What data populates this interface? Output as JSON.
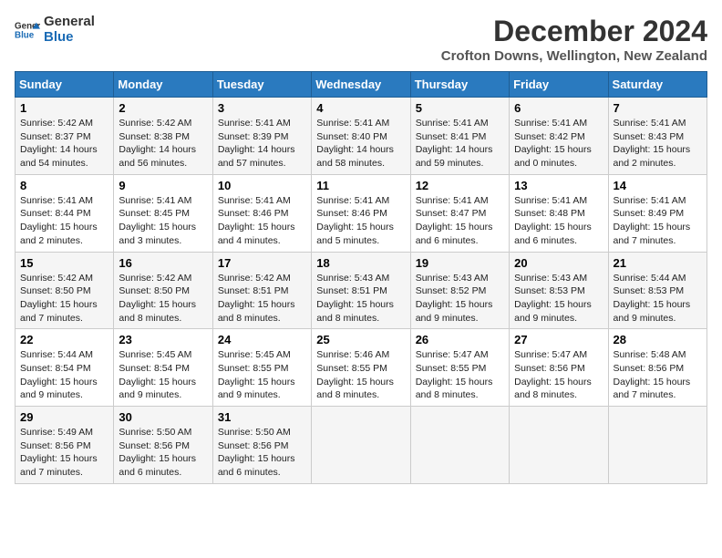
{
  "header": {
    "logo_line1": "General",
    "logo_line2": "Blue",
    "month": "December 2024",
    "location": "Crofton Downs, Wellington, New Zealand"
  },
  "weekdays": [
    "Sunday",
    "Monday",
    "Tuesday",
    "Wednesday",
    "Thursday",
    "Friday",
    "Saturday"
  ],
  "weeks": [
    [
      {
        "day": "1",
        "info": "Sunrise: 5:42 AM\nSunset: 8:37 PM\nDaylight: 14 hours\nand 54 minutes."
      },
      {
        "day": "2",
        "info": "Sunrise: 5:42 AM\nSunset: 8:38 PM\nDaylight: 14 hours\nand 56 minutes."
      },
      {
        "day": "3",
        "info": "Sunrise: 5:41 AM\nSunset: 8:39 PM\nDaylight: 14 hours\nand 57 minutes."
      },
      {
        "day": "4",
        "info": "Sunrise: 5:41 AM\nSunset: 8:40 PM\nDaylight: 14 hours\nand 58 minutes."
      },
      {
        "day": "5",
        "info": "Sunrise: 5:41 AM\nSunset: 8:41 PM\nDaylight: 14 hours\nand 59 minutes."
      },
      {
        "day": "6",
        "info": "Sunrise: 5:41 AM\nSunset: 8:42 PM\nDaylight: 15 hours\nand 0 minutes."
      },
      {
        "day": "7",
        "info": "Sunrise: 5:41 AM\nSunset: 8:43 PM\nDaylight: 15 hours\nand 2 minutes."
      }
    ],
    [
      {
        "day": "8",
        "info": "Sunrise: 5:41 AM\nSunset: 8:44 PM\nDaylight: 15 hours\nand 2 minutes."
      },
      {
        "day": "9",
        "info": "Sunrise: 5:41 AM\nSunset: 8:45 PM\nDaylight: 15 hours\nand 3 minutes."
      },
      {
        "day": "10",
        "info": "Sunrise: 5:41 AM\nSunset: 8:46 PM\nDaylight: 15 hours\nand 4 minutes."
      },
      {
        "day": "11",
        "info": "Sunrise: 5:41 AM\nSunset: 8:46 PM\nDaylight: 15 hours\nand 5 minutes."
      },
      {
        "day": "12",
        "info": "Sunrise: 5:41 AM\nSunset: 8:47 PM\nDaylight: 15 hours\nand 6 minutes."
      },
      {
        "day": "13",
        "info": "Sunrise: 5:41 AM\nSunset: 8:48 PM\nDaylight: 15 hours\nand 6 minutes."
      },
      {
        "day": "14",
        "info": "Sunrise: 5:41 AM\nSunset: 8:49 PM\nDaylight: 15 hours\nand 7 minutes."
      }
    ],
    [
      {
        "day": "15",
        "info": "Sunrise: 5:42 AM\nSunset: 8:50 PM\nDaylight: 15 hours\nand 7 minutes."
      },
      {
        "day": "16",
        "info": "Sunrise: 5:42 AM\nSunset: 8:50 PM\nDaylight: 15 hours\nand 8 minutes."
      },
      {
        "day": "17",
        "info": "Sunrise: 5:42 AM\nSunset: 8:51 PM\nDaylight: 15 hours\nand 8 minutes."
      },
      {
        "day": "18",
        "info": "Sunrise: 5:43 AM\nSunset: 8:51 PM\nDaylight: 15 hours\nand 8 minutes."
      },
      {
        "day": "19",
        "info": "Sunrise: 5:43 AM\nSunset: 8:52 PM\nDaylight: 15 hours\nand 9 minutes."
      },
      {
        "day": "20",
        "info": "Sunrise: 5:43 AM\nSunset: 8:53 PM\nDaylight: 15 hours\nand 9 minutes."
      },
      {
        "day": "21",
        "info": "Sunrise: 5:44 AM\nSunset: 8:53 PM\nDaylight: 15 hours\nand 9 minutes."
      }
    ],
    [
      {
        "day": "22",
        "info": "Sunrise: 5:44 AM\nSunset: 8:54 PM\nDaylight: 15 hours\nand 9 minutes."
      },
      {
        "day": "23",
        "info": "Sunrise: 5:45 AM\nSunset: 8:54 PM\nDaylight: 15 hours\nand 9 minutes."
      },
      {
        "day": "24",
        "info": "Sunrise: 5:45 AM\nSunset: 8:55 PM\nDaylight: 15 hours\nand 9 minutes."
      },
      {
        "day": "25",
        "info": "Sunrise: 5:46 AM\nSunset: 8:55 PM\nDaylight: 15 hours\nand 8 minutes."
      },
      {
        "day": "26",
        "info": "Sunrise: 5:47 AM\nSunset: 8:55 PM\nDaylight: 15 hours\nand 8 minutes."
      },
      {
        "day": "27",
        "info": "Sunrise: 5:47 AM\nSunset: 8:56 PM\nDaylight: 15 hours\nand 8 minutes."
      },
      {
        "day": "28",
        "info": "Sunrise: 5:48 AM\nSunset: 8:56 PM\nDaylight: 15 hours\nand 7 minutes."
      }
    ],
    [
      {
        "day": "29",
        "info": "Sunrise: 5:49 AM\nSunset: 8:56 PM\nDaylight: 15 hours\nand 7 minutes."
      },
      {
        "day": "30",
        "info": "Sunrise: 5:50 AM\nSunset: 8:56 PM\nDaylight: 15 hours\nand 6 minutes."
      },
      {
        "day": "31",
        "info": "Sunrise: 5:50 AM\nSunset: 8:56 PM\nDaylight: 15 hours\nand 6 minutes."
      },
      null,
      null,
      null,
      null
    ]
  ]
}
